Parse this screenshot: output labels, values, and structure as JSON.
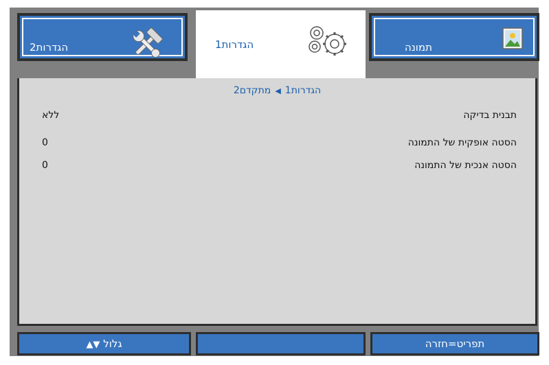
{
  "tabs": [
    {
      "label": "הגדרות2",
      "icon": "tools-icon"
    },
    {
      "label": "הגדרות1",
      "icon": "gears-icon"
    },
    {
      "label": "תמונה",
      "icon": "picture-icon"
    }
  ],
  "breadcrumb": {
    "parent": "הגדרות1",
    "current": "מתקדם2"
  },
  "settings": [
    {
      "label": "תבנית בדיקה",
      "value": "ללא"
    },
    {
      "label": "הסטה אופקית של התמונה",
      "value": "0"
    },
    {
      "label": "הסטה אנכית של התמונה",
      "value": "0"
    }
  ],
  "footer": {
    "scroll_label": "גלול",
    "middle_label": "",
    "back_label": "תפריט=חזרה"
  },
  "colors": {
    "tab_blue": "#3a76bf",
    "accent_text": "#1a5fae",
    "panel": "#d7d7d7",
    "frame": "#808080"
  }
}
